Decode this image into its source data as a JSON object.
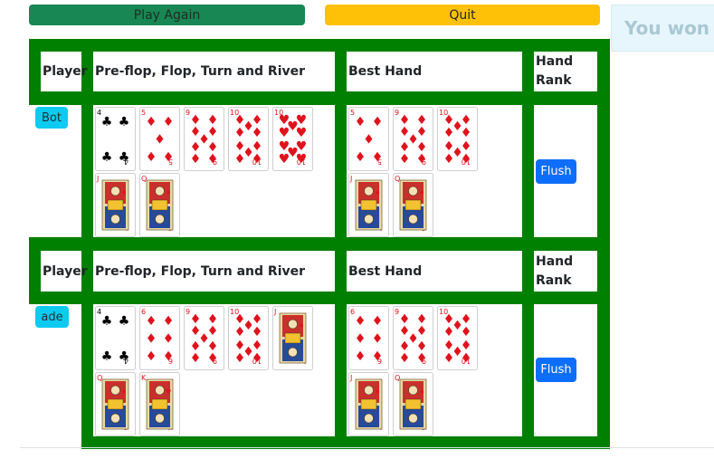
{
  "controls": {
    "play_again": "Play Again",
    "quit": "Quit"
  },
  "toast": {
    "message": "You won"
  },
  "headers": {
    "player": "Player",
    "cards": "Pre-flop, Flop, Turn and River",
    "best": "Best Hand",
    "rank_line1": "Hand",
    "rank_line2": "Rank"
  },
  "players": [
    {
      "name": "Bot",
      "rank": "Flush",
      "cards": [
        {
          "rank": "4",
          "suit": "clubs"
        },
        {
          "rank": "5",
          "suit": "diamonds"
        },
        {
          "rank": "9",
          "suit": "diamonds"
        },
        {
          "rank": "10",
          "suit": "diamonds"
        },
        {
          "rank": "10",
          "suit": "hearts"
        },
        {
          "rank": "J",
          "suit": "diamonds"
        },
        {
          "rank": "Q",
          "suit": "diamonds"
        }
      ],
      "best": [
        {
          "rank": "5",
          "suit": "diamonds"
        },
        {
          "rank": "9",
          "suit": "diamonds"
        },
        {
          "rank": "10",
          "suit": "diamonds"
        },
        {
          "rank": "J",
          "suit": "diamonds"
        },
        {
          "rank": "Q",
          "suit": "diamonds"
        }
      ]
    },
    {
      "name": "ade",
      "rank": "Flush",
      "cards": [
        {
          "rank": "4",
          "suit": "clubs"
        },
        {
          "rank": "6",
          "suit": "diamonds"
        },
        {
          "rank": "9",
          "suit": "diamonds"
        },
        {
          "rank": "10",
          "suit": "diamonds"
        },
        {
          "rank": "J",
          "suit": "diamonds"
        },
        {
          "rank": "Q",
          "suit": "diamonds"
        },
        {
          "rank": "K",
          "suit": "hearts"
        }
      ],
      "best": [
        {
          "rank": "6",
          "suit": "diamonds"
        },
        {
          "rank": "9",
          "suit": "diamonds"
        },
        {
          "rank": "10",
          "suit": "diamonds"
        },
        {
          "rank": "J",
          "suit": "diamonds"
        },
        {
          "rank": "Q",
          "suit": "diamonds"
        }
      ]
    }
  ],
  "colors": {
    "table_green": "#008000",
    "play_again": "#198754",
    "quit": "#ffc107",
    "player_badge": "#0dcaf0",
    "rank_button": "#0d6efd",
    "red_suit": "#e0121c",
    "black_suit": "#000000"
  }
}
